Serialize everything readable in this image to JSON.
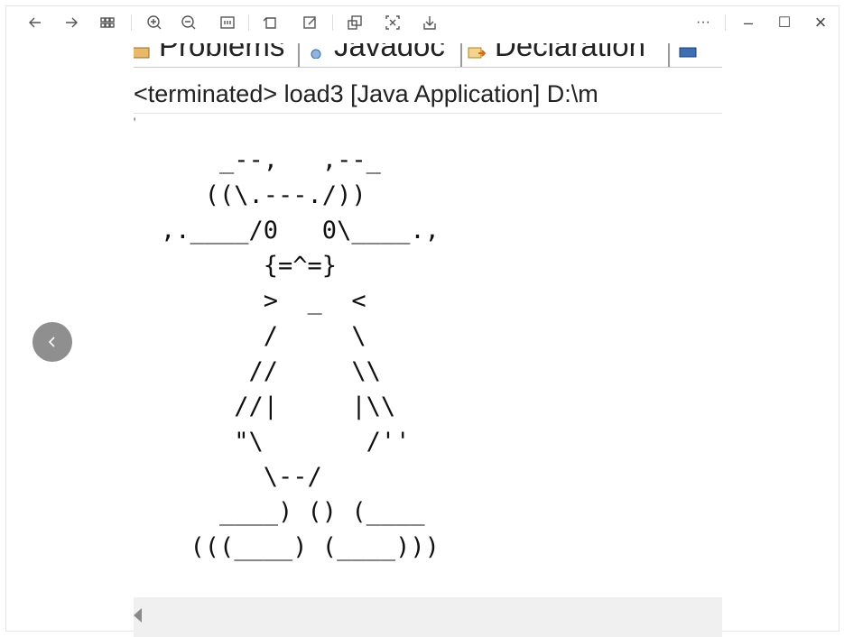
{
  "toolbar": {
    "left_icons": [
      "back-arrow-icon",
      "forward-arrow-icon",
      "grid-view-icon",
      "zoom-in-icon",
      "zoom-out-icon",
      "actual-size-icon",
      "rotate-icon",
      "edit-icon",
      "copy-image-icon",
      "ocr-icon",
      "download-icon"
    ],
    "more_label": "···",
    "minimize_label": "–",
    "maximize_label": "☐",
    "close_label": "×"
  },
  "screenshot": {
    "tabs": [
      "Problems",
      "Javadoc",
      "Declaration"
    ],
    "console_header": "<terminated> load3 [Java Application] D:\\m",
    "ascii_art": "    _--,   ,--_\n   ((\\.---./))\n,.____/0   0\\____.,\n       {=^=}\n       >  _  <\n       /     \\\n      //     \\\\\n     //|     |\\\\\n     \"\\       /''\n       \\--/\n    ____) () (____\n  (((____) (____)))"
  },
  "colors": {
    "toolbar_icon": "#555555",
    "nav_button_bg": "#8f8f8f",
    "scrollbar_bg": "#f0f0f0"
  }
}
